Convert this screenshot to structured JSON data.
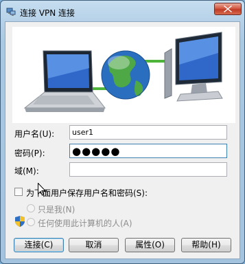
{
  "window": {
    "title": "连接 VPN 连接"
  },
  "form": {
    "username_label": "用户名(U):",
    "username_value": "user1",
    "password_label": "密码(P):",
    "password_mask": "●●●●●",
    "domain_label": "域(M):",
    "domain_value": ""
  },
  "save_credentials": {
    "label": "为下面用户保存用户名和密码(S):",
    "checked": false,
    "options": [
      {
        "label": "只是我(N)",
        "selected": false,
        "enabled": false
      },
      {
        "label": "任何使用此计算机的人(A)",
        "selected": false,
        "enabled": false
      }
    ]
  },
  "buttons": {
    "connect": "连接(C)",
    "cancel": "取消",
    "properties": "属性(O)",
    "help": "帮助(H)"
  },
  "colors": {
    "title_bar": "#b6d1e8",
    "close_button": "#c9432b",
    "dialog_background": "#f0f0f0",
    "link_line": "#4fb43a"
  },
  "icons": [
    "vpn-network-icon",
    "close-icon",
    "laptop-icon",
    "globe-icon",
    "server-icon",
    "uac-shield-icon",
    "mouse-cursor-icon"
  ]
}
